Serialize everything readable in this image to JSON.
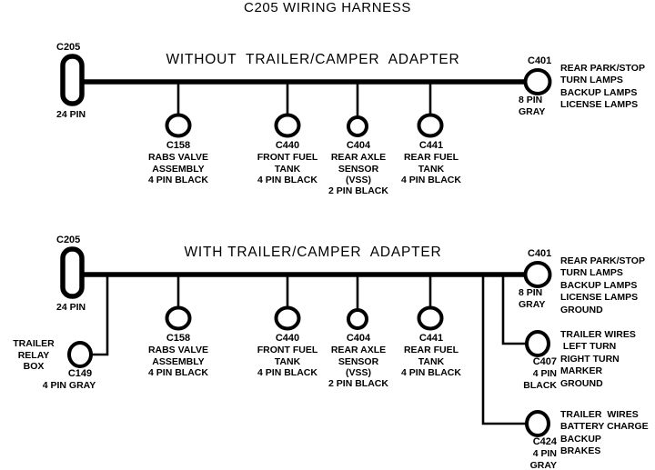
{
  "page": {
    "title": "C205 WIRING HARNESS"
  },
  "sections": [
    {
      "id": "without-adapter",
      "heading": "WITHOUT  TRAILER/CAMPER  ADAPTER",
      "source_connector": {
        "name": "C205",
        "pins": "24 PIN"
      },
      "branches": [
        {
          "name": "C158",
          "desc": "RABS VALVE\nASSEMBLY",
          "pins": "4 PIN BLACK"
        },
        {
          "name": "C440",
          "desc": "FRONT FUEL\nTANK",
          "pins": "4 PIN BLACK"
        },
        {
          "name": "C404",
          "desc": "REAR AXLE\nSENSOR\n(VSS)",
          "pins": "2 PIN BLACK"
        },
        {
          "name": "C441",
          "desc": "REAR FUEL\nTANK",
          "pins": "4 PIN BLACK"
        }
      ],
      "end_connector": {
        "name": "C401",
        "pins": "8 PIN\nGRAY",
        "functions": "REAR PARK/STOP\nTURN LAMPS\nBACKUP LAMPS\nLICENSE LAMPS"
      }
    },
    {
      "id": "with-adapter",
      "heading": "WITH TRAILER/CAMPER  ADAPTER",
      "source_connector": {
        "name": "C205",
        "pins": "24 PIN"
      },
      "trailer_relay": {
        "box_label": "TRAILER\nRELAY\nBOX",
        "name": "C149",
        "pins": "4 PIN GRAY"
      },
      "branches": [
        {
          "name": "C158",
          "desc": "RABS VALVE\nASSEMBLY",
          "pins": "4 PIN BLACK"
        },
        {
          "name": "C440",
          "desc": "FRONT FUEL\nTANK",
          "pins": "4 PIN BLACK"
        },
        {
          "name": "C404",
          "desc": "REAR AXLE\nSENSOR\n(VSS)",
          "pins": "2 PIN BLACK"
        },
        {
          "name": "C441",
          "desc": "REAR FUEL\nTANK",
          "pins": "4 PIN BLACK"
        }
      ],
      "end_connectors": [
        {
          "name": "C401",
          "pins": "8 PIN\nGRAY",
          "functions": "REAR PARK/STOP\nTURN LAMPS\nBACKUP LAMPS\nLICENSE LAMPS\nGROUND"
        },
        {
          "name": "C407",
          "pins": "4 PIN\nBLACK",
          "functions": "TRAILER WIRES\n LEFT TURN\nRIGHT TURN\nMARKER\nGROUND"
        },
        {
          "name": "C424",
          "pins": "4 PIN\nGRAY",
          "functions": "TRAILER  WIRES\nBATTERY CHARGE\nBACKUP\nBRAKES"
        }
      ]
    }
  ],
  "colors": {
    "line": "#000000",
    "background": "#ffffff",
    "text": "#000000"
  }
}
